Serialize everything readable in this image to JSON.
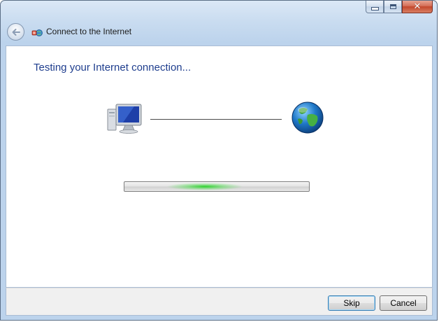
{
  "window": {
    "title": "Connect to the Internet",
    "caption_buttons": {
      "minimize_icon": "minimize-icon",
      "maximize_icon": "maximize-icon",
      "close_icon": "close-icon"
    }
  },
  "nav": {
    "back_icon": "back-arrow-icon"
  },
  "main": {
    "heading": "Testing your Internet connection...",
    "progress_state": "indeterminate",
    "icons": {
      "computer": "computer-icon",
      "globe": "globe-icon"
    }
  },
  "footer": {
    "skip_label": "Skip",
    "cancel_label": "Cancel"
  },
  "colors": {
    "heading": "#1f3e8e",
    "progress_glow": "#26d226",
    "frame": "#bcd3ec"
  }
}
